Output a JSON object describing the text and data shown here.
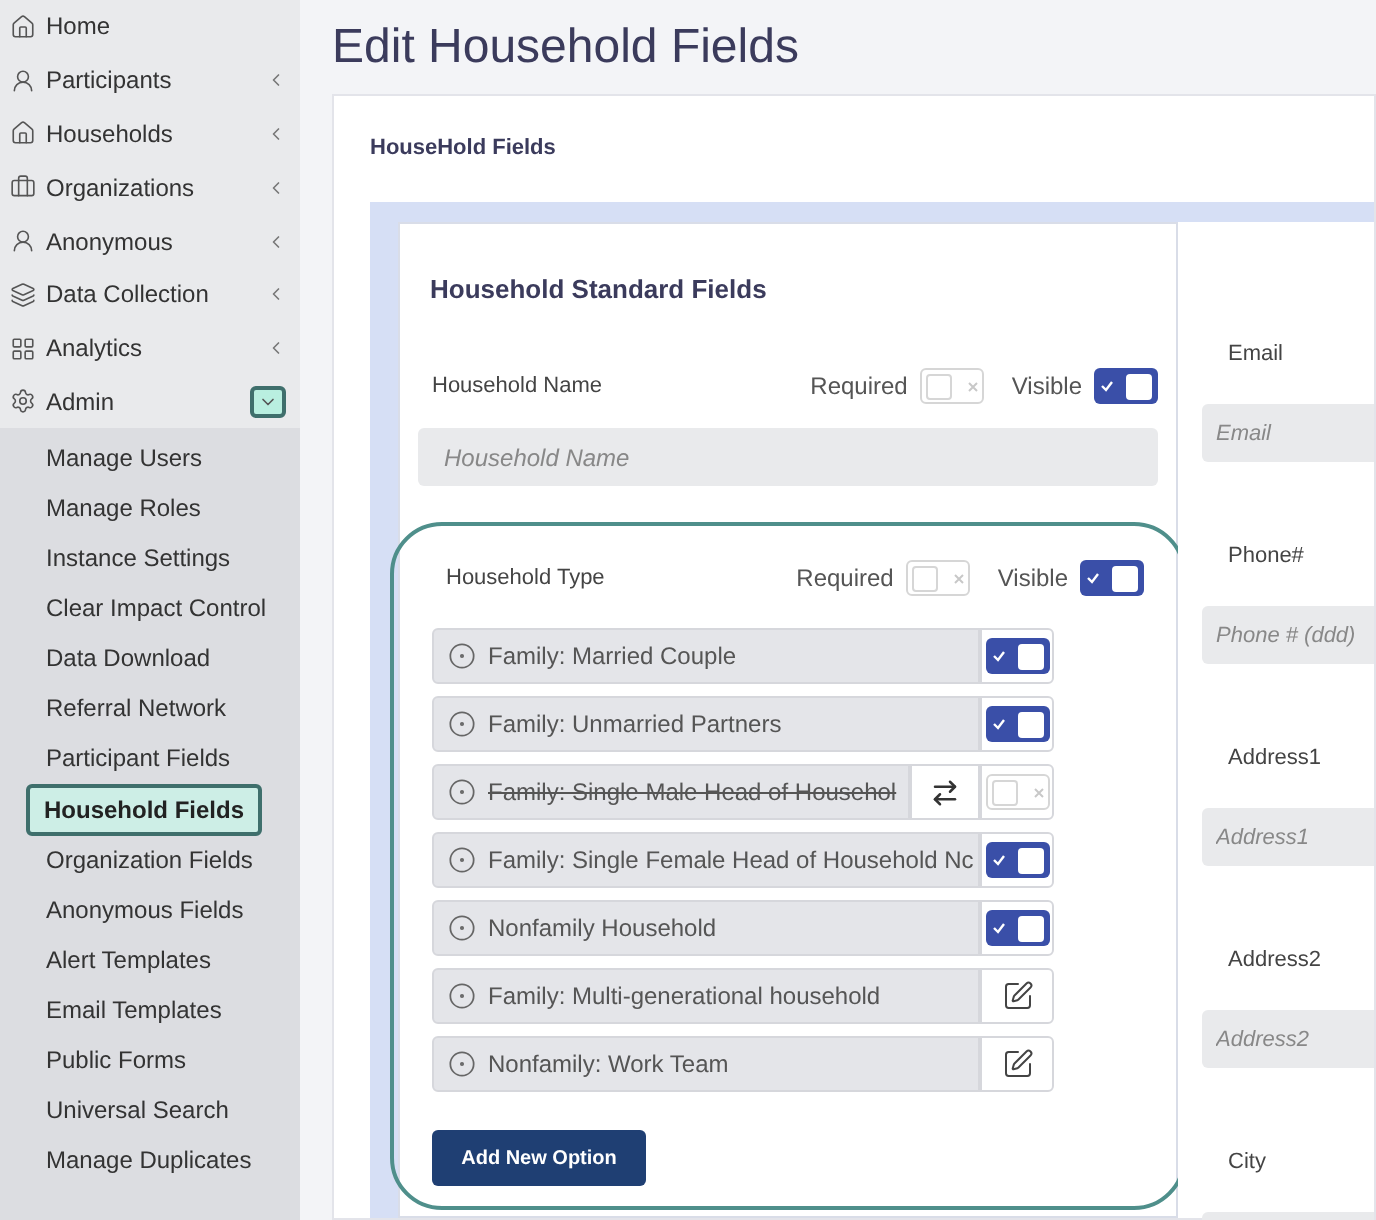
{
  "sidebar": {
    "items": [
      {
        "label": "Home"
      },
      {
        "label": "Participants",
        "expanded": false
      },
      {
        "label": "Households",
        "expanded": false
      },
      {
        "label": "Organizations",
        "expanded": false
      },
      {
        "label": "Anonymous",
        "expanded": false
      },
      {
        "label": "Data Collection",
        "expanded": false
      },
      {
        "label": "Analytics",
        "expanded": false
      },
      {
        "label": "Admin",
        "expanded": true
      }
    ],
    "submenu": [
      {
        "label": "Manage Users",
        "selected": false
      },
      {
        "label": "Manage Roles",
        "selected": false
      },
      {
        "label": "Instance Settings",
        "selected": false
      },
      {
        "label": "Clear Impact Control",
        "selected": false
      },
      {
        "label": "Data Download",
        "selected": false
      },
      {
        "label": "Referral Network",
        "selected": false
      },
      {
        "label": "Participant Fields",
        "selected": false
      },
      {
        "label": "Household Fields",
        "selected": true
      },
      {
        "label": "Organization Fields",
        "selected": false
      },
      {
        "label": "Anonymous Fields",
        "selected": false
      },
      {
        "label": "Alert Templates",
        "selected": false
      },
      {
        "label": "Email Templates",
        "selected": false
      },
      {
        "label": "Public Forms",
        "selected": false
      },
      {
        "label": "Universal Search",
        "selected": false
      },
      {
        "label": "Manage Duplicates",
        "selected": false
      }
    ]
  },
  "page_title": "Edit Household Fields",
  "card_title": "HouseHold Fields",
  "section_title": "Household Standard Fields",
  "fields": [
    {
      "label": "Household Name",
      "required_label": "Required",
      "required": false,
      "visible_label": "Visible",
      "visible": true,
      "placeholder": "Household Name"
    },
    {
      "label": "Household Type",
      "required_label": "Required",
      "required": false,
      "visible_label": "Visible",
      "visible": true,
      "options": [
        {
          "label": "Family: Married Couple",
          "kind": "toggle",
          "on": true
        },
        {
          "label": "Family: Unmarried Partners",
          "kind": "toggle",
          "on": true
        },
        {
          "label": "Family: Single Male Head of Househol",
          "kind": "toggle",
          "on": false
        },
        {
          "label": "Family: Single Female Head of Household Nc",
          "kind": "toggle",
          "on": true
        },
        {
          "label": "Nonfamily Household",
          "kind": "toggle",
          "on": true
        },
        {
          "label": "Family: Multi-generational household",
          "kind": "edit",
          "on": true
        },
        {
          "label": "Nonfamily: Work Team",
          "kind": "edit",
          "on": true
        }
      ],
      "add_button": "Add New Option"
    }
  ],
  "right_fields": [
    {
      "label": "Email",
      "placeholder": "Email"
    },
    {
      "label": "Phone#",
      "placeholder": "Phone # (ddd)"
    },
    {
      "label": "Address1",
      "placeholder": "Address1"
    },
    {
      "label": "Address2",
      "placeholder": "Address2"
    },
    {
      "label": "City"
    }
  ]
}
